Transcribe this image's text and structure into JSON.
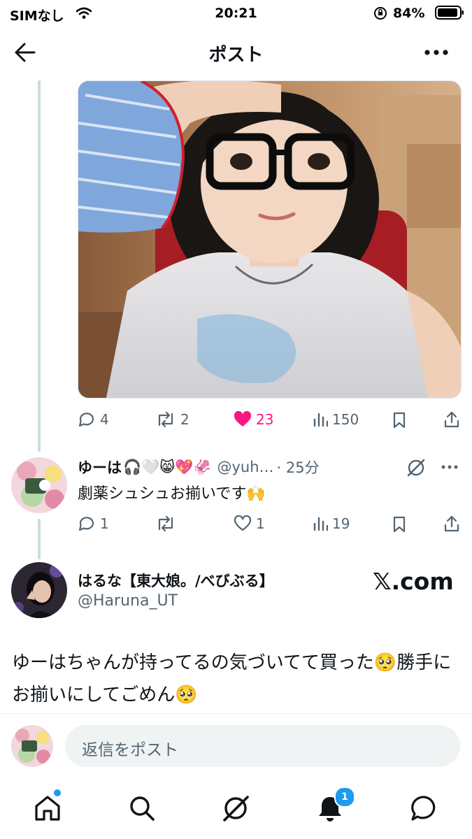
{
  "status_bar": {
    "carrier": "SIMなし",
    "time": "20:21",
    "battery": "84%"
  },
  "header": {
    "title": "ポスト"
  },
  "main_post": {
    "actions": {
      "replies": "4",
      "reposts": "2",
      "likes": "23",
      "views": "150"
    }
  },
  "reply_post": {
    "name": "ゆーは",
    "name_emojis": "🎧🤍😸💖🦑",
    "handle": "@yuh…",
    "time": "· 25分",
    "text": "劇薬シュシュお揃いです🙌",
    "actions": {
      "replies": "1",
      "reposts": "",
      "likes": "1",
      "views": "19"
    }
  },
  "focus_post": {
    "name": "はるな【東大娘。/べびぶる】",
    "handle": "@Haruna_UT",
    "watermark": "𝕏.com",
    "text": "ゆーはちゃんが持ってるの気づいてて買った🥺勝手にお揃いにしてごめん🥺"
  },
  "reply_bar": {
    "placeholder": "返信をポスト"
  },
  "bottom_nav": {
    "notification_count": "1"
  },
  "colors": {
    "accent": "#1d9bf0",
    "like": "#f91880",
    "muted": "#536471"
  },
  "icons": [
    "back-arrow-icon",
    "more-icon",
    "reply-icon",
    "repost-icon",
    "heart-icon",
    "views-icon",
    "bookmark-icon",
    "share-icon",
    "grok-icon",
    "home-icon",
    "search-icon",
    "bell-icon",
    "messages-icon"
  ]
}
